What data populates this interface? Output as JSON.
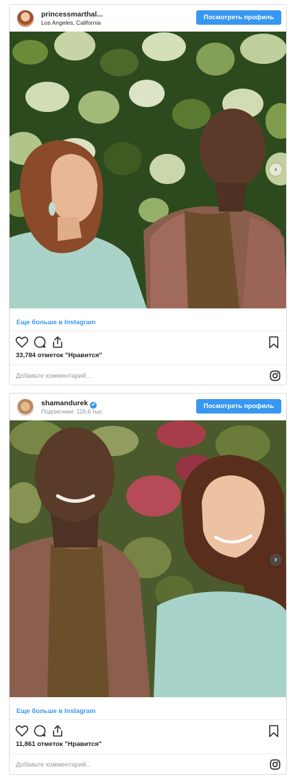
{
  "posts": [
    {
      "username": "princessmarthal...",
      "subtitle": "Los Angeles, California",
      "view_profile_label": "Посмотреть профиль",
      "more_label": "Еще больше в Instagram",
      "likes_text": "33,784 отметок \"Нравится\"",
      "comment_placeholder": "Добавьте комментарий...",
      "verified": false
    },
    {
      "username": "shamandurek",
      "subtitle": "Подписчики: 119,6 тыс.",
      "view_profile_label": "Посмотреть профиль",
      "more_label": "Еще больше в Instagram",
      "likes_text": "11,861 отметок \"Нравится\"",
      "comment_placeholder": "Добавьте комментарий...",
      "verified": true
    }
  ],
  "icons": {
    "verified": "✔",
    "next": "›"
  },
  "colors": {
    "accent": "#3897f0",
    "border": "#dbdbdb",
    "text": "#262626",
    "muted": "#999999"
  }
}
